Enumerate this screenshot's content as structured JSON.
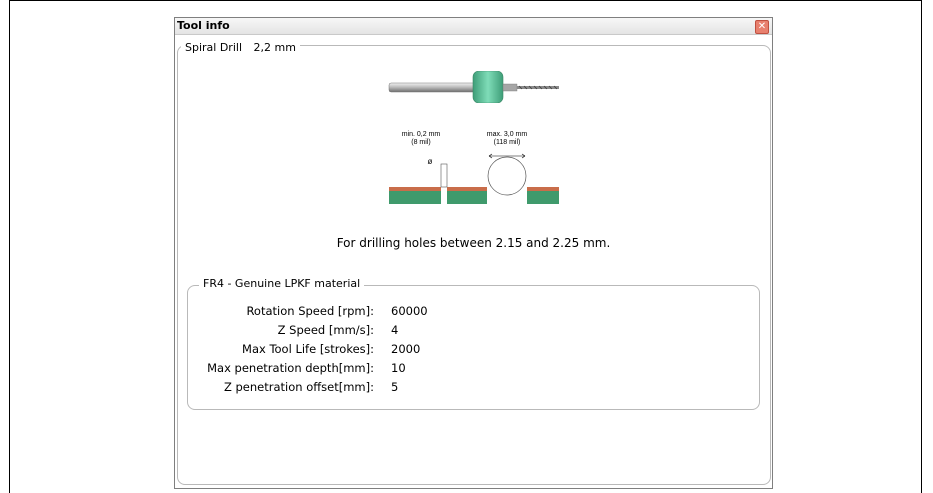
{
  "window": {
    "title": "Tool info",
    "close_glyph": "✕"
  },
  "tool": {
    "name": "Spiral Drill",
    "size": "2,2 mm",
    "description": "For drilling holes between 2.15 and 2.25 mm."
  },
  "diagram": {
    "min_label": "min. 0,2 mm",
    "min_sub": "(8 mil)",
    "max_label": "max. 3,0 mm",
    "max_sub": "(118 mil)",
    "diameter_symbol": "ø"
  },
  "material": {
    "title": "FR4 - Genuine LPKF material",
    "params": [
      {
        "label": "Rotation Speed [rpm]:",
        "value": "60000"
      },
      {
        "label": "Z Speed [mm/s]:",
        "value": "4"
      },
      {
        "label": "Max Tool Life [strokes]:",
        "value": "2000"
      },
      {
        "label": "Max penetration depth[mm]:",
        "value": "10"
      },
      {
        "label": "Z penetration offset[mm]:",
        "value": "5"
      }
    ]
  },
  "colors": {
    "collar": "#5fc6a0",
    "board": "#3f9a6c",
    "copper": "#c96d4a"
  }
}
